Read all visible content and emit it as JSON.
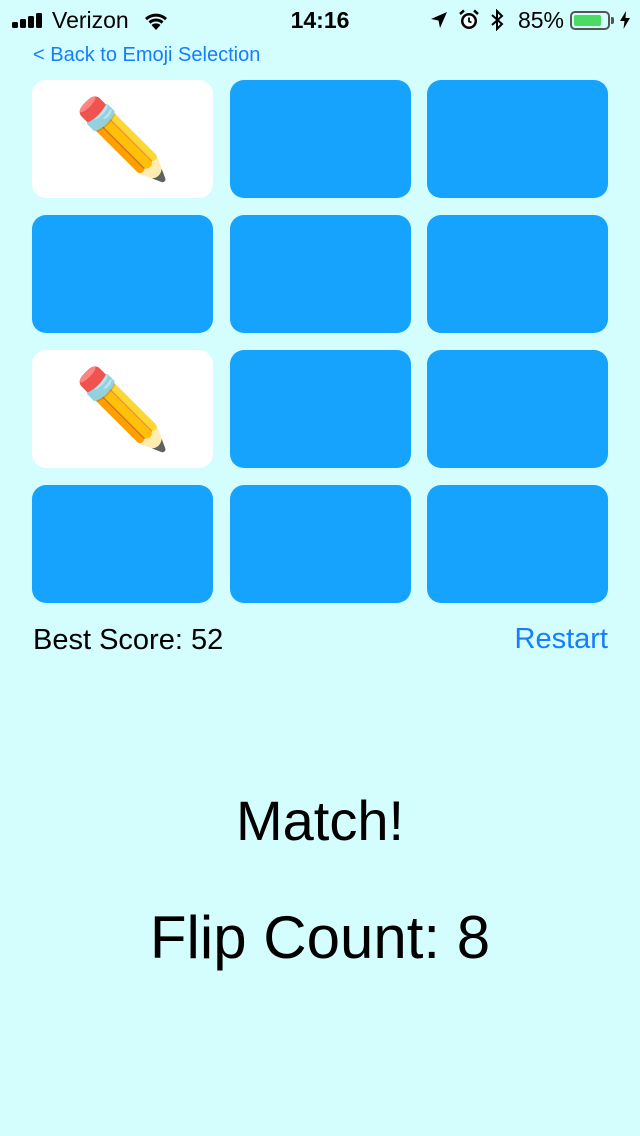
{
  "status_bar": {
    "carrier": "Verizon",
    "time": "14:16",
    "battery_percent": "85%",
    "battery_level": 0.85,
    "signal_bars": 4,
    "icons": [
      "signal-icon",
      "wifi-icon",
      "location-arrow-icon",
      "alarm-icon",
      "bluetooth-icon",
      "battery-icon",
      "charging-bolt-icon"
    ]
  },
  "nav": {
    "back_label": "< Back to Emoji Selection"
  },
  "board": {
    "card_back_color": "#16a3fe",
    "card_face_color": "#ffffff",
    "cards": [
      {
        "face_up": true,
        "emoji": "✏️"
      },
      {
        "face_up": false,
        "emoji": ""
      },
      {
        "face_up": false,
        "emoji": ""
      },
      {
        "face_up": false,
        "emoji": ""
      },
      {
        "face_up": false,
        "emoji": ""
      },
      {
        "face_up": false,
        "emoji": ""
      },
      {
        "face_up": true,
        "emoji": "✏️"
      },
      {
        "face_up": false,
        "emoji": ""
      },
      {
        "face_up": false,
        "emoji": ""
      },
      {
        "face_up": false,
        "emoji": ""
      },
      {
        "face_up": false,
        "emoji": ""
      },
      {
        "face_up": false,
        "emoji": ""
      }
    ]
  },
  "score": {
    "best_score_label": "Best Score: 52",
    "restart_label": "Restart"
  },
  "result": {
    "message": "Match!",
    "flip_count_label": "Flip Count: 8"
  },
  "colors": {
    "background": "#d4fdfe",
    "accent": "#147efb"
  }
}
